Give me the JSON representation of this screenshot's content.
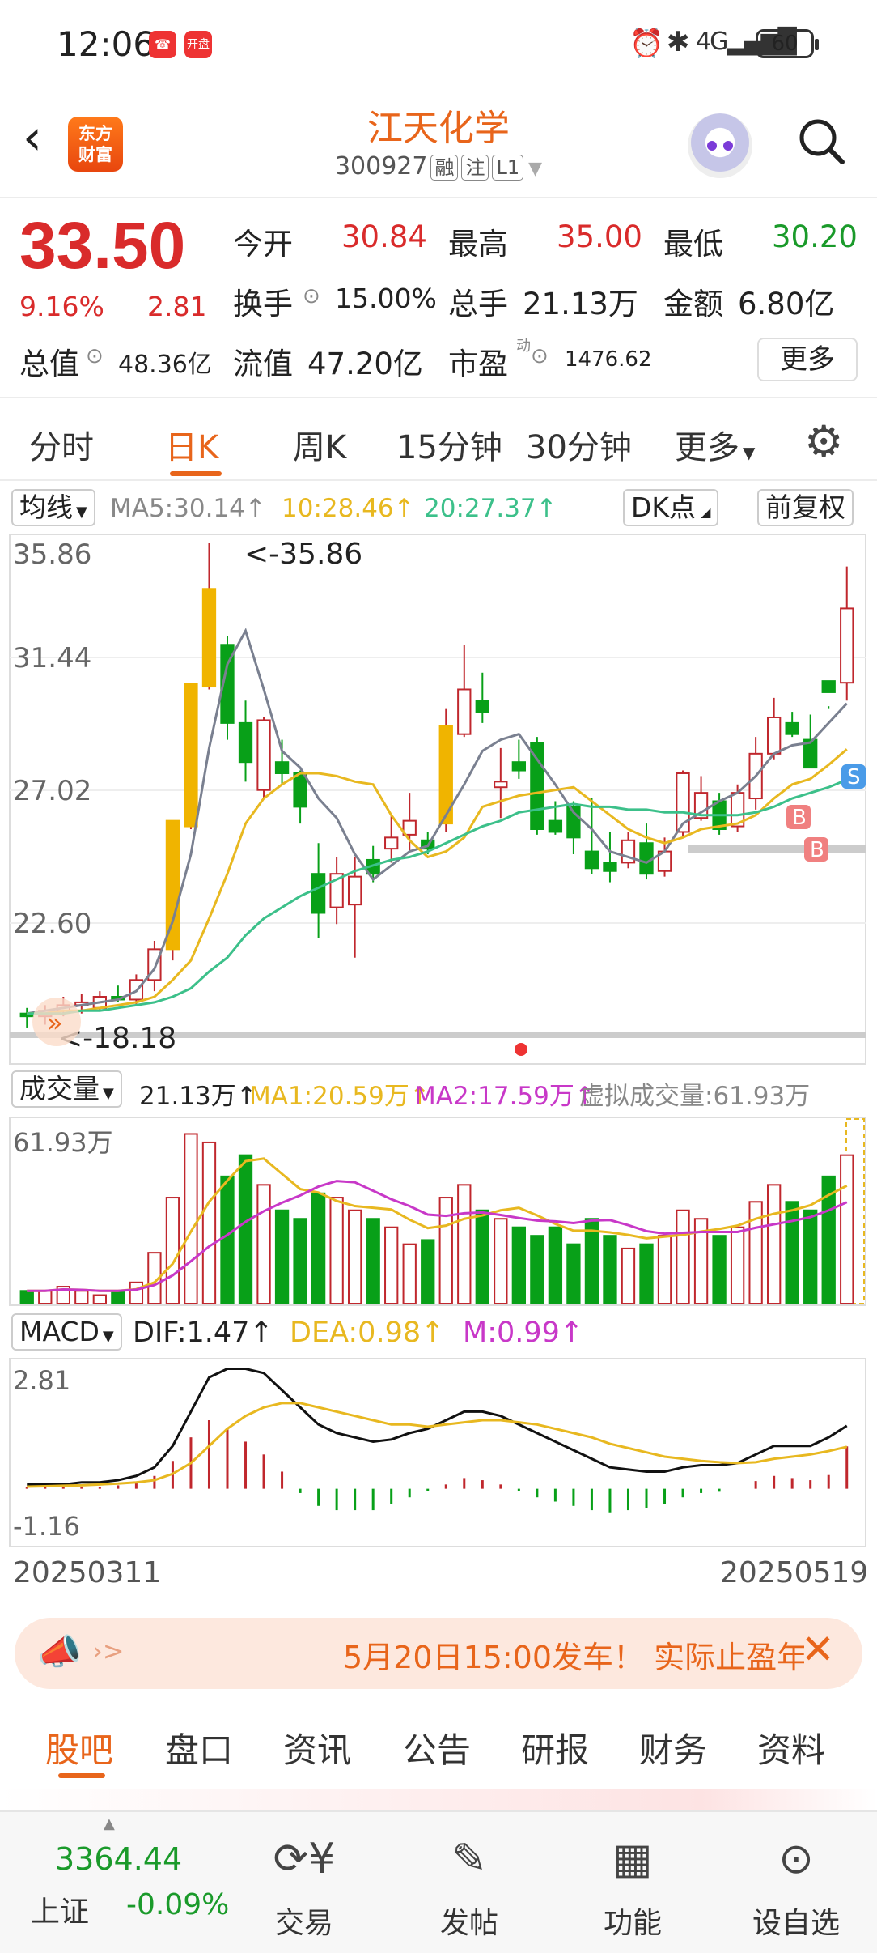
{
  "status_bar": {
    "time": "12:06",
    "app_badge": "开盘",
    "battery": "60"
  },
  "header": {
    "back_icon": "chevron-left-icon",
    "logo_line1": "东方",
    "logo_line2": "财富",
    "stock_name": "江天化学",
    "stock_code": "300927",
    "tags": [
      "融",
      "注",
      "L1"
    ]
  },
  "quote": {
    "price": "33.50",
    "change_pct": "9.16%",
    "change_amt": "2.81",
    "open_label": "今开",
    "open": "30.84",
    "high_label": "最高",
    "high": "35.00",
    "low_label": "最低",
    "low": "30.20",
    "turnover_label": "换手",
    "turnover": "15.00%",
    "volume_label": "总手",
    "volume": "21.13万",
    "amount_label": "金额",
    "amount": "6.80亿",
    "mktcap_label": "总值",
    "mktcap": "48.36亿",
    "float_label": "流值",
    "float": "47.20亿",
    "pe_label": "市盈",
    "pe_sup": "动",
    "pe": "1476.62",
    "more_btn": "更多"
  },
  "tabs": [
    "分时",
    "日K",
    "周K",
    "15分钟",
    "30分钟",
    "更多"
  ],
  "ma_row": {
    "selector": "均线",
    "ma5": "MA5:30.14↑",
    "ma10": "10:28.46↑",
    "ma20": "20:27.37↑",
    "dk": "DK点",
    "adjust": "前复权"
  },
  "kline": {
    "y_labels": [
      "35.86",
      "31.44",
      "27.02",
      "22.60"
    ],
    "max_marker": "<-35.86",
    "min_marker": "<-18.18",
    "ymin": 18.18,
    "ymax": 35.86
  },
  "volume_row": {
    "selector": "成交量",
    "vol": "21.13万↑",
    "ma1": "MA1:20.59万↑",
    "ma2": "MA2:17.59万↑",
    "virtual": "虚拟成交量:61.93万",
    "max_label": "61.93万"
  },
  "macd_row": {
    "selector": "MACD",
    "dif": "DIF:1.47↑",
    "dea": "DEA:0.98↑",
    "m": "M:0.99↑",
    "top_label": "2.81",
    "bottom_label": "-1.16"
  },
  "dates": {
    "start": "20250311",
    "end": "20250519"
  },
  "banner": {
    "text": "5月20日15:00发车！ 实际止盈年"
  },
  "subtabs": [
    "股吧",
    "盘口",
    "资讯",
    "公告",
    "研报",
    "财务",
    "资料"
  ],
  "bottom_nav": {
    "index_value": "3364.44",
    "index_name": "上证",
    "index_change": "-0.09%",
    "items": [
      "交易",
      "发帖",
      "功能",
      "设自选"
    ]
  },
  "chart_data": {
    "type": "candlestick",
    "candles": [
      [
        19.0,
        19.2,
        18.5,
        18.9
      ],
      [
        18.9,
        19.3,
        18.6,
        19.1
      ],
      [
        19.1,
        19.6,
        18.9,
        19.3
      ],
      [
        19.3,
        19.7,
        19.0,
        19.4
      ],
      [
        19.2,
        19.8,
        19.1,
        19.6
      ],
      [
        19.6,
        20.0,
        19.4,
        19.5
      ],
      [
        19.5,
        20.4,
        19.3,
        20.2
      ],
      [
        20.2,
        21.6,
        19.8,
        21.3
      ],
      [
        21.3,
        25.9,
        20.9,
        25.9
      ],
      [
        25.7,
        30.8,
        25.6,
        30.8
      ],
      [
        30.7,
        35.86,
        30.6,
        34.2
      ],
      [
        32.2,
        32.5,
        28.8,
        29.4
      ],
      [
        29.4,
        30.2,
        27.3,
        28.0
      ],
      [
        27.0,
        29.6,
        26.7,
        29.5
      ],
      [
        28.0,
        28.8,
        27.2,
        27.6
      ],
      [
        27.6,
        27.7,
        25.8,
        26.4
      ],
      [
        24.0,
        25.1,
        21.7,
        22.6
      ],
      [
        22.8,
        24.6,
        22.2,
        24.0
      ],
      [
        22.9,
        24.6,
        21.0,
        23.9
      ],
      [
        24.5,
        25.0,
        23.7,
        24.0
      ],
      [
        24.9,
        26.1,
        24.4,
        25.3
      ],
      [
        25.4,
        26.9,
        24.8,
        25.9
      ],
      [
        25.2,
        25.5,
        24.7,
        24.9
      ],
      [
        25.8,
        29.9,
        25.5,
        29.3
      ],
      [
        29.0,
        32.2,
        28.9,
        30.6
      ],
      [
        30.2,
        31.2,
        29.4,
        29.8
      ],
      [
        27.1,
        28.5,
        26.0,
        27.3
      ],
      [
        28.0,
        28.8,
        27.4,
        27.7
      ],
      [
        28.7,
        28.9,
        25.4,
        25.6
      ],
      [
        25.9,
        26.6,
        25.4,
        25.5
      ],
      [
        26.4,
        26.6,
        24.7,
        25.3
      ],
      [
        24.8,
        26.7,
        24.0,
        24.2
      ],
      [
        24.4,
        25.5,
        23.7,
        24.1
      ],
      [
        24.4,
        25.5,
        24.2,
        25.2
      ],
      [
        25.1,
        25.8,
        23.8,
        24.0
      ],
      [
        24.1,
        25.3,
        23.9,
        24.8
      ],
      [
        25.5,
        27.7,
        25.3,
        27.6
      ],
      [
        26.0,
        27.5,
        25.9,
        26.9
      ],
      [
        26.6,
        26.9,
        25.4,
        25.6
      ],
      [
        25.7,
        27.2,
        25.5,
        26.9
      ],
      [
        26.7,
        28.9,
        26.3,
        28.3
      ],
      [
        28.3,
        30.3,
        28.1,
        29.6
      ],
      [
        29.4,
        29.8,
        28.9,
        29.0
      ],
      [
        28.8,
        29.7,
        27.8,
        27.8
      ],
      [
        30.9,
        30.0,
        29.9,
        30.5
      ],
      [
        30.84,
        35.0,
        30.2,
        33.5
      ]
    ],
    "ma5": [
      19.0,
      19.1,
      19.2,
      19.3,
      19.4,
      19.5,
      19.8,
      20.6,
      22.3,
      24.7,
      28.5,
      31.5,
      32.7,
      30.6,
      28.4,
      27.8,
      26.7,
      26.0,
      24.7,
      23.8,
      24.3,
      24.8,
      25.0,
      26.1,
      27.2,
      28.4,
      28.8,
      29.0,
      28.1,
      27.2,
      26.2,
      25.6,
      24.8,
      24.6,
      24.4,
      24.8,
      25.8,
      26.2,
      26.6,
      26.9,
      27.5,
      28.3,
      28.6,
      28.7,
      29.4,
      30.1
    ],
    "ma10": [
      19.0,
      19.0,
      19.1,
      19.1,
      19.2,
      19.3,
      19.4,
      19.6,
      20.2,
      20.9,
      22.4,
      24.0,
      25.8,
      26.7,
      27.2,
      27.6,
      27.6,
      27.5,
      27.3,
      27.2,
      26.1,
      25.2,
      24.6,
      24.8,
      25.3,
      26.4,
      26.6,
      26.8,
      26.9,
      27.0,
      27.1,
      26.6,
      26.1,
      25.6,
      25.3,
      25.1,
      25.3,
      25.6,
      25.7,
      25.8,
      26.1,
      26.7,
      27.2,
      27.4,
      27.9,
      28.46
    ],
    "ma20": [
      19.0,
      19.0,
      19.0,
      19.1,
      19.1,
      19.2,
      19.3,
      19.4,
      19.6,
      19.9,
      20.5,
      21.0,
      21.8,
      22.4,
      22.8,
      23.2,
      23.5,
      23.8,
      24.1,
      24.3,
      24.5,
      24.6,
      24.8,
      25.1,
      25.4,
      25.7,
      25.9,
      26.2,
      26.3,
      26.4,
      26.5,
      26.4,
      26.4,
      26.3,
      26.3,
      26.2,
      26.2,
      26.1,
      26.1,
      26.1,
      26.2,
      26.4,
      26.7,
      26.9,
      27.1,
      27.37
    ],
    "volume": [
      3,
      3,
      4,
      3,
      2,
      3,
      5,
      12,
      25,
      40,
      38,
      30,
      35,
      28,
      22,
      20,
      26,
      25,
      22,
      20,
      18,
      14,
      15,
      25,
      28,
      22,
      20,
      18,
      16,
      18,
      14,
      20,
      16,
      13,
      14,
      16,
      22,
      20,
      16,
      18,
      24,
      28,
      24,
      22,
      30,
      35
    ],
    "macd_dif": [
      0.1,
      0.1,
      0.1,
      0.15,
      0.15,
      0.2,
      0.3,
      0.5,
      1.0,
      1.8,
      2.6,
      2.8,
      2.8,
      2.7,
      2.3,
      1.9,
      1.5,
      1.3,
      1.2,
      1.1,
      1.15,
      1.3,
      1.4,
      1.6,
      1.8,
      1.8,
      1.7,
      1.5,
      1.3,
      1.1,
      0.9,
      0.7,
      0.5,
      0.45,
      0.4,
      0.4,
      0.5,
      0.55,
      0.55,
      0.6,
      0.8,
      1.0,
      1.0,
      1.0,
      1.2,
      1.47
    ],
    "macd_dea": [
      0.05,
      0.06,
      0.07,
      0.08,
      0.1,
      0.12,
      0.15,
      0.2,
      0.35,
      0.6,
      1.0,
      1.4,
      1.7,
      1.9,
      2.0,
      2.0,
      1.9,
      1.8,
      1.7,
      1.6,
      1.5,
      1.5,
      1.45,
      1.5,
      1.55,
      1.6,
      1.6,
      1.55,
      1.5,
      1.4,
      1.3,
      1.2,
      1.05,
      0.95,
      0.85,
      0.75,
      0.7,
      0.65,
      0.62,
      0.6,
      0.62,
      0.7,
      0.75,
      0.8,
      0.88,
      0.98
    ],
    "macd_hist": [
      0.05,
      0.05,
      0.05,
      0.05,
      0.05,
      0.08,
      0.15,
      0.3,
      0.65,
      1.2,
      1.6,
      1.4,
      1.1,
      0.8,
      0.4,
      -0.1,
      -0.4,
      -0.5,
      -0.5,
      -0.5,
      -0.35,
      -0.2,
      -0.05,
      0.1,
      0.25,
      0.2,
      0.1,
      -0.05,
      -0.2,
      -0.3,
      -0.4,
      -0.5,
      -0.55,
      -0.5,
      -0.45,
      -0.35,
      -0.2,
      -0.1,
      -0.07,
      0.0,
      0.18,
      0.3,
      0.25,
      0.2,
      0.32,
      0.99
    ]
  }
}
